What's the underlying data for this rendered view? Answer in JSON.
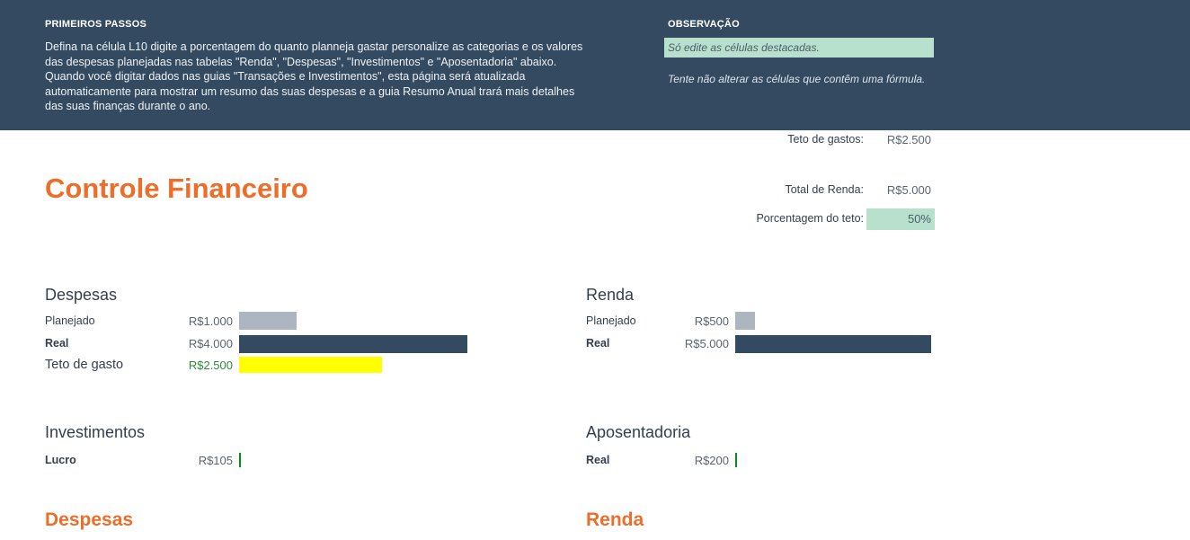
{
  "banner": {
    "primeiros_heading": "PRIMEIROS PASSOS",
    "primeiros_p1": "Defina na célula L10 digite a porcentagem do quanto planneja gastar personalize as categorias e os valores das despesas planejadas nas tabelas \"Renda\", \"Despesas\", \"Investimentos\" e \"Aposentadoria\" abaixo.",
    "primeiros_p2": "Quando você digitar dados nas guias \"Transações e Investimentos\", esta página será atualizada automaticamente para mostrar um resumo das suas despesas e a guia Resumo Anual trará mais detalhes das suas finanças durante o ano.",
    "observacao_heading": "OBSERVAÇÃO",
    "observacao_note": "Só edite as células destacadas.",
    "observacao_text": "Tente não alterar as células que contêm uma fórmula."
  },
  "title": "Controle Financeiro",
  "summary": {
    "teto_label": "Teto de gastos:",
    "teto_value": "R$2.500",
    "renda_label": "Total de Renda:",
    "renda_value": "R$5.000",
    "pct_label": "Porcentagem do teto:",
    "pct_value": "50%"
  },
  "despesas": {
    "title": "Despesas",
    "rows": [
      {
        "label": "Planejado",
        "value": "R$1.000",
        "amount": 1000
      },
      {
        "label": "Real",
        "value": "R$4.000",
        "amount": 4000
      },
      {
        "label": "Teto de gasto",
        "value": "R$2.500",
        "amount": 2500
      }
    ]
  },
  "renda": {
    "title": "Renda",
    "rows": [
      {
        "label": "Planejado",
        "value": "R$500",
        "amount": 500
      },
      {
        "label": "Real",
        "value": "R$5.000",
        "amount": 5000
      }
    ]
  },
  "investimentos": {
    "title": "Investimentos",
    "rows": [
      {
        "label": "Lucro",
        "value": "R$105",
        "amount": 105
      }
    ]
  },
  "aposentadoria": {
    "title": "Aposentadoria",
    "rows": [
      {
        "label": "Real",
        "value": "R$200",
        "amount": 200
      }
    ]
  },
  "bottom": {
    "despesas_title": "Despesas",
    "renda_title": "Renda"
  },
  "colors": {
    "banner": "#344a61",
    "accent": "#ed6d2b",
    "highlight": "#b7e1cd",
    "planned_bar": "#adb5c0",
    "real_bar": "#344a61",
    "cap_bar": "#ffff00",
    "tick": "#0a8a1a"
  }
}
